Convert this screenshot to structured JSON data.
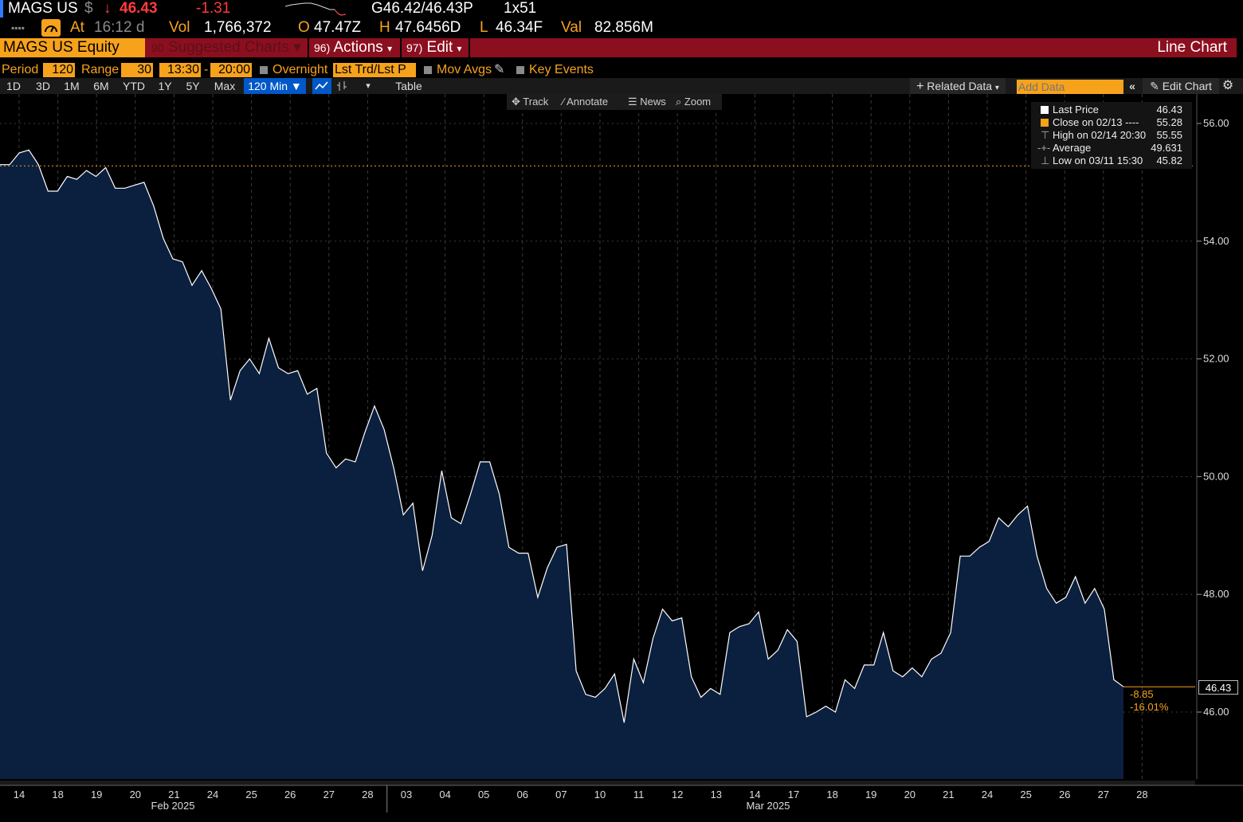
{
  "quote": {
    "ticker": "MAGS US",
    "currency": "$",
    "last": "46.43",
    "change": "-1.31",
    "bid_ask": "G46.42/46.43P",
    "size": "1x51",
    "at_label": "At",
    "time": "16:12 d",
    "vol_label": "Vol",
    "volume": "1,766,372",
    "open_label": "O",
    "open": "47.47Z",
    "high_label": "H",
    "high": "47.6456D",
    "low_label": "L",
    "low": "46.34F",
    "val_label": "Val",
    "value": "82.856M"
  },
  "menubar": {
    "security": "MAGS US Equity",
    "suggested_num": "90",
    "suggested": "Suggested Charts",
    "actions_num": "96)",
    "actions": "Actions",
    "edit_num": "97)",
    "edit": "Edit",
    "title": "Line Chart"
  },
  "settings": {
    "period_label": "Period",
    "period_value": "120",
    "range_label": "Range",
    "range_value": "30",
    "start_time": "13:30",
    "dash": "-",
    "end_time": "20:00",
    "overnight": "Overnight",
    "lst_trd": "Lst Trd/Lst P",
    "mov_avgs": "Mov Avgs",
    "key_events": "Key Events"
  },
  "periods": {
    "buttons": [
      "1D",
      "3D",
      "1M",
      "6M",
      "YTD",
      "1Y",
      "5Y",
      "Max"
    ],
    "interval": "120 Min",
    "table": "Table",
    "related_data": "Related Data",
    "add_data_placeholder": "Add Data",
    "edit_chart": "Edit Chart"
  },
  "toolbar": {
    "track": "Track",
    "annotate": "Annotate",
    "news": "News",
    "zoom": "Zoom"
  },
  "legend": {
    "rows": [
      {
        "label": "Last Price",
        "value": "46.43",
        "color": "#ffffff"
      },
      {
        "label": "Close on 02/13 ----",
        "value": "55.28",
        "color": "#f7a21b"
      },
      {
        "label": "High on 02/14 20:30",
        "value": "55.55",
        "color": "#888888"
      },
      {
        "label": "Average",
        "value": "49.631",
        "color": "#888888"
      },
      {
        "label": "Low on 03/11 15:30",
        "value": "45.82",
        "color": "#888888"
      }
    ]
  },
  "price_tag": "46.43",
  "change_abs": "-8.85",
  "change_pct": "-16.01%",
  "colors": {
    "accent": "#f7a21b",
    "menubar": "#8c0f1f",
    "area": "#0b1f3f",
    "line": "#ffffff",
    "down": "#ff3b3b"
  },
  "chart_data": {
    "type": "area",
    "ylim": [
      45,
      57
    ],
    "yticks": [
      "46.00",
      "48.00",
      "50.00",
      "52.00",
      "54.00",
      "56.00"
    ],
    "reference_line": 55.28,
    "x_day_labels": [
      "14",
      "18",
      "19",
      "20",
      "21",
      "24",
      "25",
      "26",
      "27",
      "28",
      "03",
      "04",
      "05",
      "06",
      "07",
      "10",
      "11",
      "12",
      "13",
      "14",
      "17",
      "18",
      "19",
      "20",
      "21",
      "24",
      "25",
      "26",
      "27",
      "28"
    ],
    "month_labels": [
      "Feb 2025",
      "Mar 2025"
    ],
    "series": [
      {
        "values": [
          55.3,
          55.3,
          55.5,
          55.55,
          55.3,
          54.85,
          54.85,
          55.1,
          55.05,
          55.2,
          55.1,
          55.25,
          54.9,
          54.9,
          54.95,
          55.0,
          54.6,
          54.05,
          53.7,
          53.65,
          53.25,
          53.5,
          53.2,
          52.85,
          51.3,
          51.8,
          52.0,
          51.75,
          52.35,
          51.85,
          51.75,
          51.8,
          51.4,
          51.5,
          50.4,
          50.15,
          50.3,
          50.25,
          50.75,
          51.2,
          50.8,
          50.15,
          49.35,
          49.55,
          48.4,
          49.0,
          50.1,
          49.3,
          49.2,
          49.7,
          50.25,
          50.25,
          49.7,
          48.8,
          48.7,
          48.7,
          47.95,
          48.45,
          48.8,
          48.85,
          46.7,
          46.3,
          46.25,
          46.4,
          46.65,
          45.82,
          46.9,
          46.5,
          47.25,
          47.75,
          47.55,
          47.6,
          46.6,
          46.25,
          46.4,
          46.3,
          47.35,
          47.45,
          47.5,
          47.7,
          46.9,
          47.05,
          47.4,
          47.2,
          45.92,
          46.0,
          46.1,
          46.0,
          46.55,
          46.4,
          46.8,
          46.8,
          47.35,
          46.7,
          46.6,
          46.75,
          46.6,
          46.9,
          47.0,
          47.35,
          48.65,
          48.65,
          48.8,
          48.9,
          49.3,
          49.15,
          49.35,
          49.5,
          48.65,
          48.1,
          47.85,
          47.95,
          48.3,
          47.85,
          48.1,
          47.75,
          46.55,
          46.43
        ]
      }
    ]
  }
}
